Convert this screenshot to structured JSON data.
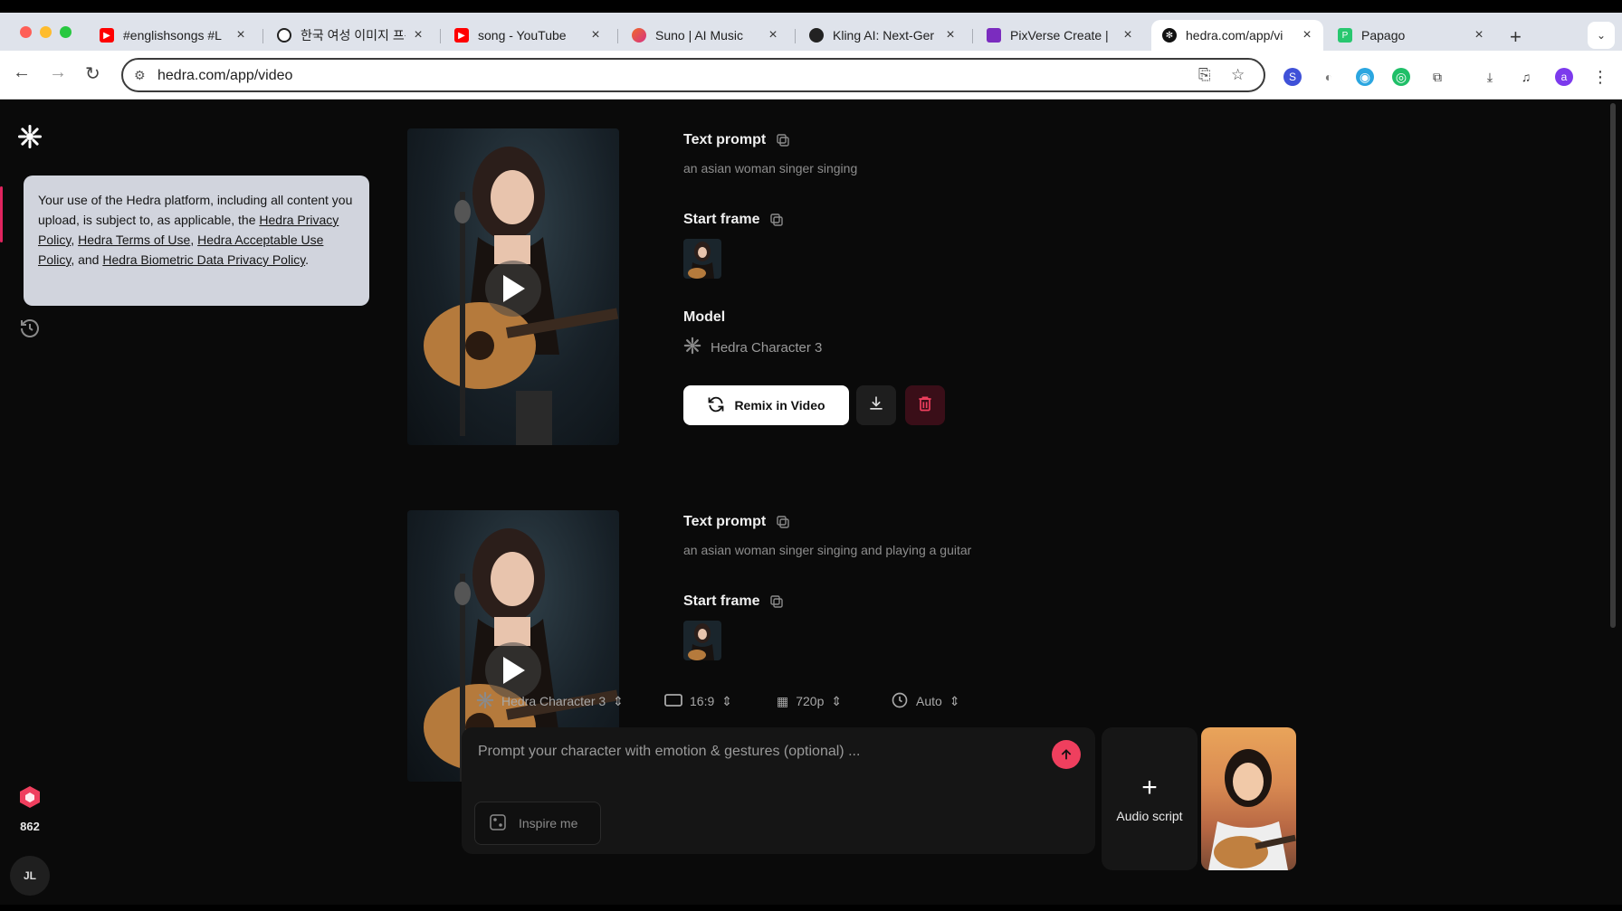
{
  "browser": {
    "tabs": [
      {
        "title": "#englishsongs #L",
        "favicon": "youtube-icon",
        "color": "#ff0000"
      },
      {
        "title": "한국 여성 이미지 프롬",
        "favicon": "openai-icon",
        "color": "#222222"
      },
      {
        "title": "song - YouTube",
        "favicon": "youtube-icon",
        "color": "#ff0000"
      },
      {
        "title": "Suno | AI Music",
        "favicon": "suno-icon",
        "color": "#f06a2a"
      },
      {
        "title": "Kling AI: Next-Ger",
        "favicon": "kling-icon",
        "color": "#222222"
      },
      {
        "title": "PixVerse Create |",
        "favicon": "pixverse-icon",
        "color": "#7b2cbf"
      },
      {
        "title": "hedra.com/app/vi",
        "favicon": "hedra-icon",
        "color": "#111111"
      },
      {
        "title": "Papago",
        "favicon": "papago-icon",
        "color": "#28c76f"
      }
    ],
    "url": "hedra.com/app/video",
    "profile_initial": "a"
  },
  "sidebar": {
    "credits": "862",
    "avatar_initials": "JL"
  },
  "tooltip": {
    "text1": "Your use of the Hedra platform, including all content you upload, is subject to, as applicable, the ",
    "link1": "Hedra Privacy Policy",
    "sep1": ", ",
    "link2": "Hedra Terms of Use",
    "sep2": ", ",
    "link3": "Hedra Acceptable Use Policy",
    "sep3": ", and ",
    "link4": "Hedra Biometric Data Privacy Policy",
    "end": "."
  },
  "videos": [
    {
      "text_prompt_label": "Text prompt",
      "text_prompt": "an asian woman singer singing",
      "start_frame_label": "Start frame",
      "model_label": "Model",
      "model_name": "Hedra Character 3",
      "remix_label": "Remix in Video"
    },
    {
      "text_prompt_label": "Text prompt",
      "text_prompt": "an asian woman singer singing and playing a guitar",
      "start_frame_label": "Start frame"
    }
  ],
  "composer": {
    "model": "Hedra Character 3",
    "aspect": "16:9",
    "resolution": "720p",
    "duration": "Auto",
    "placeholder": "Prompt your character with emotion & gestures (optional) ...",
    "inspire_label": "Inspire me",
    "audio_label": "Audio script"
  },
  "colors": {
    "accent": "#ef3f5e",
    "background": "#0a0a0a",
    "tooltip_bg": "#d1d4dd"
  }
}
